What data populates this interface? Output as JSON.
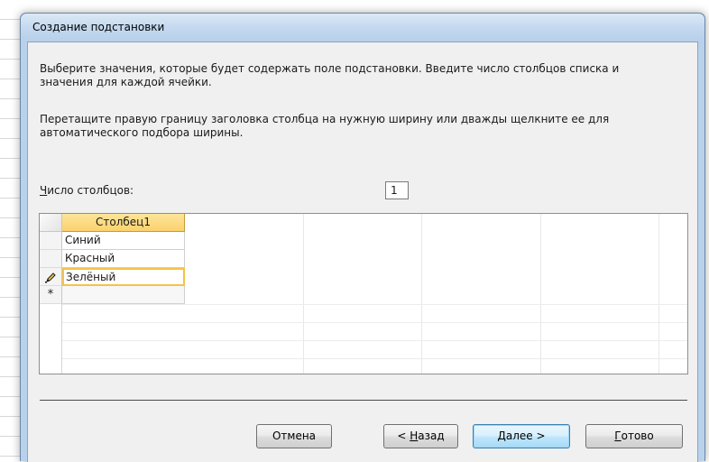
{
  "dialog": {
    "title": "Создание подстановки",
    "instruction_1": "Выберите значения, которые будет содержать поле подстановки. Введите число столбцов списка и значения для каждой ячейки.",
    "instruction_2": "Перетащите правую границу заголовка столбца на нужную ширину или дважды щелкните ее для автоматического подбора ширины."
  },
  "column_count": {
    "label_mnemonic": "Ч",
    "label_rest": "исло столбцов:",
    "value": "1"
  },
  "grid": {
    "column_header": "Столбец1",
    "rows": [
      "Синий",
      "Красный",
      "Зелёный",
      ""
    ],
    "row_markers": [
      "",
      "",
      "edit-pencil",
      "*"
    ],
    "new_row_marker": "*",
    "active_row_index": 2
  },
  "buttons": {
    "cancel": "Отмена",
    "back_prefix": "< ",
    "back_mnemonic": "Н",
    "back_rest": "азад",
    "next_mnemonic": "Д",
    "next_rest": "алее >",
    "finish_mnemonic": "Г",
    "finish_rest": "отово"
  },
  "colors": {
    "header_highlight": "#fbd26d",
    "active_cell_border": "#f5c343",
    "default_button_border": "#3c7fb1"
  }
}
